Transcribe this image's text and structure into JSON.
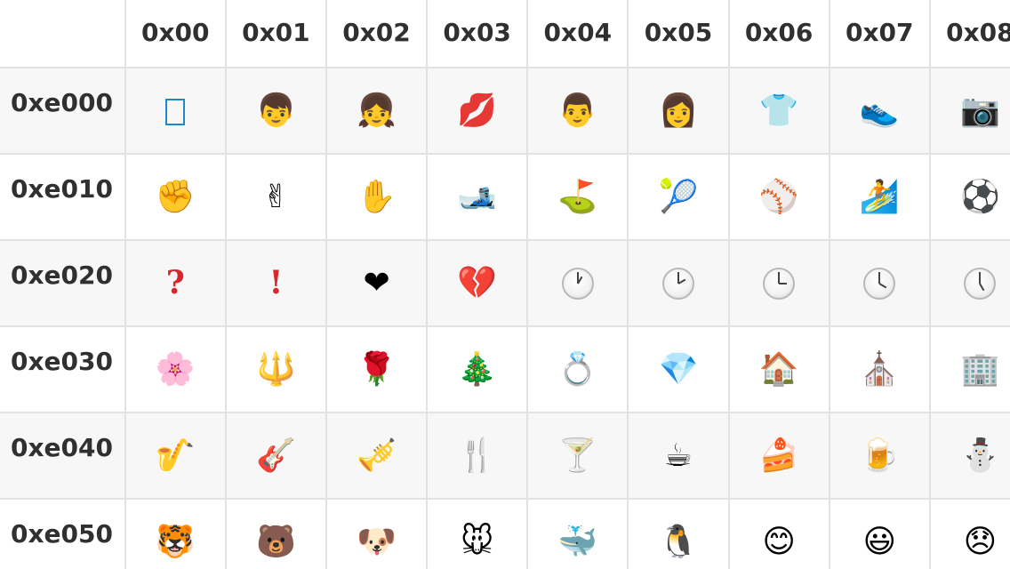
{
  "columns": [
    "0x00",
    "0x01",
    "0x02",
    "0x03",
    "0x04",
    "0x05",
    "0x06",
    "0x07",
    "0x08"
  ],
  "rows": [
    {
      "label": "0xe000",
      "cells": [
        {
          "name": "missing-glyph-box",
          "type": "box"
        },
        {
          "name": "boy-emoji",
          "glyph": "👦"
        },
        {
          "name": "girl-emoji",
          "glyph": "👧"
        },
        {
          "name": "kiss-mark-emoji",
          "glyph": "💋"
        },
        {
          "name": "man-emoji",
          "glyph": "👨"
        },
        {
          "name": "woman-emoji",
          "glyph": "👩"
        },
        {
          "name": "shirt-emoji",
          "glyph": "👕"
        },
        {
          "name": "sneaker-emoji",
          "glyph": "👟"
        },
        {
          "name": "camera-emoji",
          "glyph": "📷"
        }
      ]
    },
    {
      "label": "0xe010",
      "cells": [
        {
          "name": "raised-fist-emoji",
          "glyph": "✊"
        },
        {
          "name": "victory-hand-emoji",
          "glyph": "✌"
        },
        {
          "name": "raised-hand-emoji",
          "glyph": "✋"
        },
        {
          "name": "ski-emoji",
          "glyph": "🎿"
        },
        {
          "name": "golf-flag-emoji",
          "glyph": "⛳"
        },
        {
          "name": "tennis-ball-emoji",
          "glyph": "🎾"
        },
        {
          "name": "baseball-emoji",
          "glyph": "⚾"
        },
        {
          "name": "surfer-emoji",
          "glyph": "🏄"
        },
        {
          "name": "soccer-ball-emoji",
          "glyph": "⚽"
        }
      ]
    },
    {
      "label": "0xe020",
      "cells": [
        {
          "name": "question-mark-emoji",
          "glyph": "?",
          "type": "red"
        },
        {
          "name": "exclamation-mark-emoji",
          "glyph": "!",
          "type": "red"
        },
        {
          "name": "red-heart-emoji",
          "glyph": "❤"
        },
        {
          "name": "broken-heart-emoji",
          "glyph": "💔"
        },
        {
          "name": "clock-emoji",
          "type": "clock",
          "hour": 1
        },
        {
          "name": "clock-emoji",
          "type": "clock",
          "hour": 2
        },
        {
          "name": "clock-emoji",
          "type": "clock",
          "hour": 3
        },
        {
          "name": "clock-emoji",
          "type": "clock",
          "hour": 4
        },
        {
          "name": "clock-emoji",
          "type": "clock",
          "hour": 5
        }
      ]
    },
    {
      "label": "0xe030",
      "cells": [
        {
          "name": "cherry-blossom-emoji",
          "glyph": "🌸"
        },
        {
          "name": "trident-emblem-emoji",
          "glyph": "🔱"
        },
        {
          "name": "rose-emoji",
          "glyph": "🌹"
        },
        {
          "name": "christmas-tree-emoji",
          "glyph": "🎄"
        },
        {
          "name": "ring-emoji",
          "glyph": "💍"
        },
        {
          "name": "gem-stone-emoji",
          "glyph": "💎"
        },
        {
          "name": "house-emoji",
          "glyph": "🏠"
        },
        {
          "name": "church-emoji",
          "glyph": "⛪"
        },
        {
          "name": "office-building-emoji",
          "glyph": "🏢"
        }
      ]
    },
    {
      "label": "0xe040",
      "cells": [
        {
          "name": "saxophone-emoji",
          "glyph": "🎷"
        },
        {
          "name": "guitar-emoji",
          "glyph": "🎸"
        },
        {
          "name": "trumpet-emoji",
          "glyph": "🎺"
        },
        {
          "name": "fork-and-knife-emoji",
          "glyph": "🍴"
        },
        {
          "name": "cocktail-glass-emoji",
          "glyph": "🍸"
        },
        {
          "name": "hot-beverage-emoji",
          "glyph": "☕"
        },
        {
          "name": "shortcake-emoji",
          "glyph": "🍰"
        },
        {
          "name": "beer-mug-emoji",
          "glyph": "🍺"
        },
        {
          "name": "snowman-emoji",
          "glyph": "⛄"
        }
      ]
    },
    {
      "label": "0xe050",
      "cells": [
        {
          "name": "tiger-face-emoji",
          "glyph": "🐯"
        },
        {
          "name": "bear-face-emoji",
          "glyph": "🐻"
        },
        {
          "name": "dog-face-emoji",
          "glyph": "🐶"
        },
        {
          "name": "mouse-face-emoji",
          "glyph": "🐭"
        },
        {
          "name": "whale-emoji",
          "glyph": "🐳"
        },
        {
          "name": "penguin-emoji",
          "glyph": "🐧"
        },
        {
          "name": "smiling-face-emoji",
          "glyph": "😊"
        },
        {
          "name": "grinning-face-emoji",
          "glyph": "😃"
        },
        {
          "name": "disappointed-face-emoji",
          "glyph": "😞"
        }
      ]
    }
  ]
}
